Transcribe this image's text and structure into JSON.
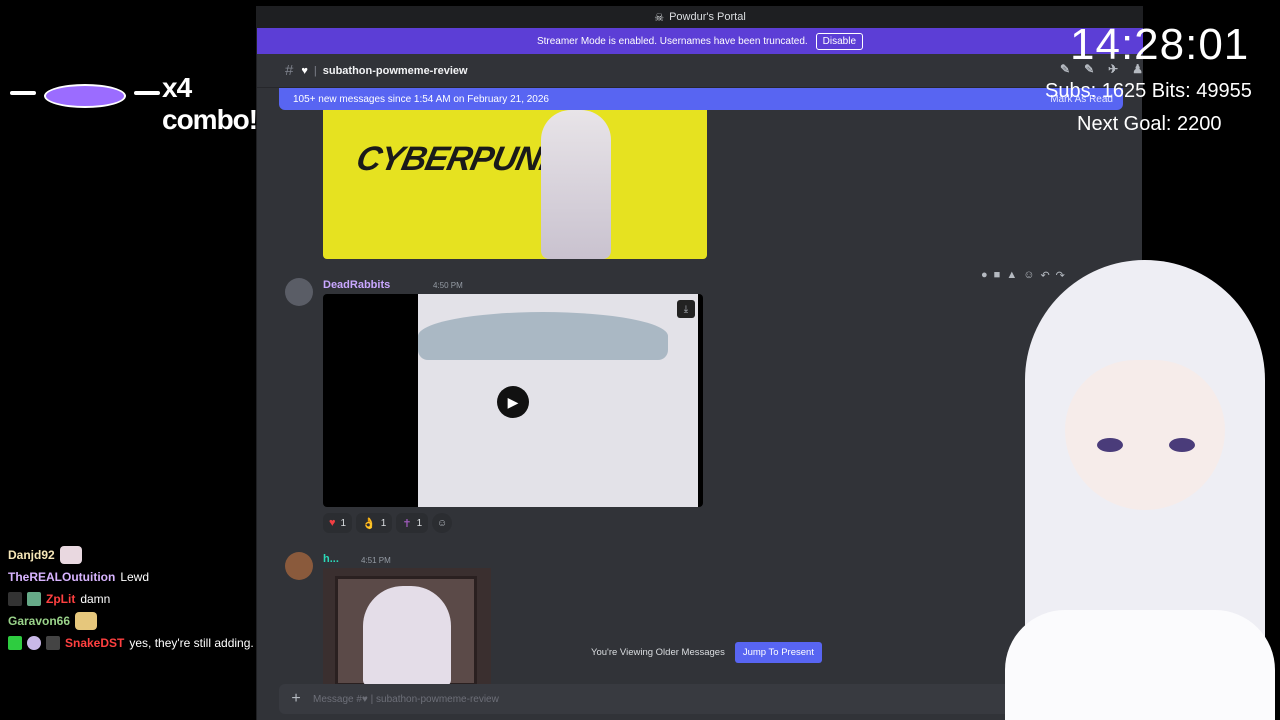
{
  "window": {
    "title": "Powdur's Portal"
  },
  "streamer_banner": {
    "text": "Streamer Mode is enabled. Usernames have been truncated.",
    "disable_label": "Disable"
  },
  "channel": {
    "name": "subathon-powmeme-review",
    "heart": "♥"
  },
  "new_messages": {
    "text": "105+ new messages since 1:54 AM on February 21, 2026",
    "mark_read": "Mark As Read"
  },
  "image1": {
    "logo_text": "CYBERPUNK"
  },
  "message2": {
    "username": "DeadRabbits",
    "timestamp": "4:50 PM",
    "reactions": [
      {
        "emoji": "♥",
        "count": "1",
        "color": "#f23f43"
      },
      {
        "emoji": "👌",
        "count": "1",
        "color": "#f0b232"
      },
      {
        "emoji": "✝",
        "count": "1",
        "color": "#9b59b6"
      }
    ]
  },
  "message3": {
    "username": "h...",
    "timestamp": "4:51 PM"
  },
  "older_bar": {
    "text": "You're Viewing Older Messages",
    "jump_label": "Jump To Present"
  },
  "composer": {
    "placeholder": "Message #♥ | subathon-powmeme-review"
  },
  "overlay": {
    "combo_text": "x4 combo!",
    "clock": "14:28:01",
    "subs_bits": "Subs: 1625  Bits: 49955",
    "next_goal": "Next Goal: 2200"
  },
  "twitch_chat": [
    {
      "user": "Danjd92",
      "color": "#f6e7b8",
      "message": ""
    },
    {
      "user": "TheREALOutuition",
      "color": "#d8b4ff",
      "message": "Lewd"
    },
    {
      "user": "ZpLit",
      "color": "#ff4040",
      "message": "damn"
    },
    {
      "user": "Garavon66",
      "color": "#9ad38a",
      "message": ""
    },
    {
      "user": "SnakeDST",
      "color": "#ff4040",
      "message": "yes, they're still adding."
    }
  ],
  "colors": {
    "discord_bg": "#313338",
    "blurple": "#5865f2",
    "streamer_bar": "#5c3ed6",
    "username_purple": "#c9a7ff",
    "cyberpunk_yellow": "#e6e220"
  }
}
